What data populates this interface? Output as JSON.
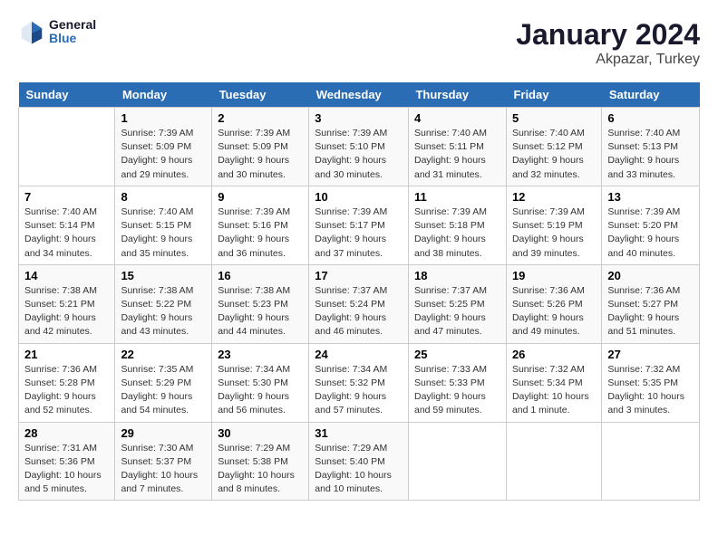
{
  "header": {
    "logo_line1": "General",
    "logo_line2": "Blue",
    "title": "January 2024",
    "subtitle": "Akpazar, Turkey"
  },
  "days_of_week": [
    "Sunday",
    "Monday",
    "Tuesday",
    "Wednesday",
    "Thursday",
    "Friday",
    "Saturday"
  ],
  "weeks": [
    [
      {
        "day": "",
        "info": ""
      },
      {
        "day": "1",
        "info": "Sunrise: 7:39 AM\nSunset: 5:09 PM\nDaylight: 9 hours\nand 29 minutes."
      },
      {
        "day": "2",
        "info": "Sunrise: 7:39 AM\nSunset: 5:09 PM\nDaylight: 9 hours\nand 30 minutes."
      },
      {
        "day": "3",
        "info": "Sunrise: 7:39 AM\nSunset: 5:10 PM\nDaylight: 9 hours\nand 30 minutes."
      },
      {
        "day": "4",
        "info": "Sunrise: 7:40 AM\nSunset: 5:11 PM\nDaylight: 9 hours\nand 31 minutes."
      },
      {
        "day": "5",
        "info": "Sunrise: 7:40 AM\nSunset: 5:12 PM\nDaylight: 9 hours\nand 32 minutes."
      },
      {
        "day": "6",
        "info": "Sunrise: 7:40 AM\nSunset: 5:13 PM\nDaylight: 9 hours\nand 33 minutes."
      }
    ],
    [
      {
        "day": "7",
        "info": "Sunrise: 7:40 AM\nSunset: 5:14 PM\nDaylight: 9 hours\nand 34 minutes."
      },
      {
        "day": "8",
        "info": "Sunrise: 7:40 AM\nSunset: 5:15 PM\nDaylight: 9 hours\nand 35 minutes."
      },
      {
        "day": "9",
        "info": "Sunrise: 7:39 AM\nSunset: 5:16 PM\nDaylight: 9 hours\nand 36 minutes."
      },
      {
        "day": "10",
        "info": "Sunrise: 7:39 AM\nSunset: 5:17 PM\nDaylight: 9 hours\nand 37 minutes."
      },
      {
        "day": "11",
        "info": "Sunrise: 7:39 AM\nSunset: 5:18 PM\nDaylight: 9 hours\nand 38 minutes."
      },
      {
        "day": "12",
        "info": "Sunrise: 7:39 AM\nSunset: 5:19 PM\nDaylight: 9 hours\nand 39 minutes."
      },
      {
        "day": "13",
        "info": "Sunrise: 7:39 AM\nSunset: 5:20 PM\nDaylight: 9 hours\nand 40 minutes."
      }
    ],
    [
      {
        "day": "14",
        "info": "Sunrise: 7:38 AM\nSunset: 5:21 PM\nDaylight: 9 hours\nand 42 minutes."
      },
      {
        "day": "15",
        "info": "Sunrise: 7:38 AM\nSunset: 5:22 PM\nDaylight: 9 hours\nand 43 minutes."
      },
      {
        "day": "16",
        "info": "Sunrise: 7:38 AM\nSunset: 5:23 PM\nDaylight: 9 hours\nand 44 minutes."
      },
      {
        "day": "17",
        "info": "Sunrise: 7:37 AM\nSunset: 5:24 PM\nDaylight: 9 hours\nand 46 minutes."
      },
      {
        "day": "18",
        "info": "Sunrise: 7:37 AM\nSunset: 5:25 PM\nDaylight: 9 hours\nand 47 minutes."
      },
      {
        "day": "19",
        "info": "Sunrise: 7:36 AM\nSunset: 5:26 PM\nDaylight: 9 hours\nand 49 minutes."
      },
      {
        "day": "20",
        "info": "Sunrise: 7:36 AM\nSunset: 5:27 PM\nDaylight: 9 hours\nand 51 minutes."
      }
    ],
    [
      {
        "day": "21",
        "info": "Sunrise: 7:36 AM\nSunset: 5:28 PM\nDaylight: 9 hours\nand 52 minutes."
      },
      {
        "day": "22",
        "info": "Sunrise: 7:35 AM\nSunset: 5:29 PM\nDaylight: 9 hours\nand 54 minutes."
      },
      {
        "day": "23",
        "info": "Sunrise: 7:34 AM\nSunset: 5:30 PM\nDaylight: 9 hours\nand 56 minutes."
      },
      {
        "day": "24",
        "info": "Sunrise: 7:34 AM\nSunset: 5:32 PM\nDaylight: 9 hours\nand 57 minutes."
      },
      {
        "day": "25",
        "info": "Sunrise: 7:33 AM\nSunset: 5:33 PM\nDaylight: 9 hours\nand 59 minutes."
      },
      {
        "day": "26",
        "info": "Sunrise: 7:32 AM\nSunset: 5:34 PM\nDaylight: 10 hours\nand 1 minute."
      },
      {
        "day": "27",
        "info": "Sunrise: 7:32 AM\nSunset: 5:35 PM\nDaylight: 10 hours\nand 3 minutes."
      }
    ],
    [
      {
        "day": "28",
        "info": "Sunrise: 7:31 AM\nSunset: 5:36 PM\nDaylight: 10 hours\nand 5 minutes."
      },
      {
        "day": "29",
        "info": "Sunrise: 7:30 AM\nSunset: 5:37 PM\nDaylight: 10 hours\nand 7 minutes."
      },
      {
        "day": "30",
        "info": "Sunrise: 7:29 AM\nSunset: 5:38 PM\nDaylight: 10 hours\nand 8 minutes."
      },
      {
        "day": "31",
        "info": "Sunrise: 7:29 AM\nSunset: 5:40 PM\nDaylight: 10 hours\nand 10 minutes."
      },
      {
        "day": "",
        "info": ""
      },
      {
        "day": "",
        "info": ""
      },
      {
        "day": "",
        "info": ""
      }
    ]
  ]
}
